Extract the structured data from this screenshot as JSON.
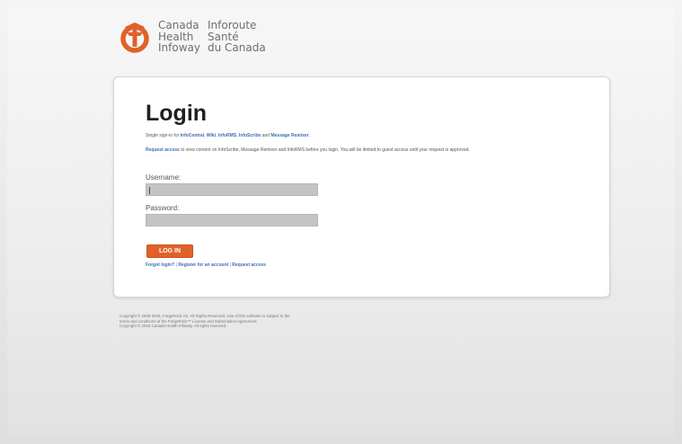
{
  "logo": {
    "col1": [
      "Canada",
      "Health",
      "Infoway"
    ],
    "col2": [
      "Inforoute",
      "Santé",
      "du Canada"
    ],
    "mark_color": "#e0622b"
  },
  "login": {
    "title": "Login",
    "signin_prefix": "Single sign-in for",
    "signin_links": [
      "InfoCentral",
      "Wiki",
      "InfoRMS",
      "InfoScribe",
      "Message Remixer"
    ],
    "signin_and": "and",
    "request_access_link": "Request access",
    "notice_text": "to view content on InfoScribe, Message Remixer and InfoRMS before you login. You will be limited to guest access until your request is approved.",
    "username_label": "Username:",
    "username_value": "",
    "password_label": "Password:",
    "password_value": "",
    "button_label": "LOG IN",
    "footer_links": [
      "Forgot login?",
      "Register for an account",
      "Request access"
    ],
    "footer_separator": "|"
  },
  "colors": {
    "accent": "#e0622b",
    "link": "#3c6fb4"
  },
  "copyright": {
    "line1": "Copyright © 2008-2015, ForgeRock AS. All Rights Reserved. Use of this software is subject to the",
    "line2": "terms and conditions of the ForgeRock™ License and Subscription Agreement.",
    "line3": "Copyright © 2015 Canada Health Infoway. All rights reserved."
  }
}
